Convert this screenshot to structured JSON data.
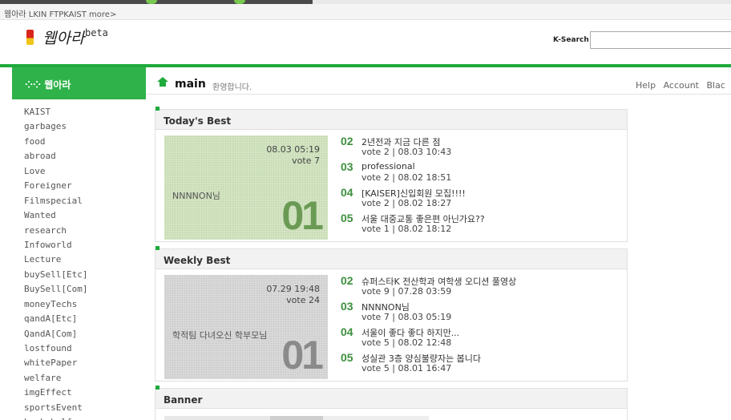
{
  "site_links": {
    "text": "웹아라 LKIN FTPKAIST more>"
  },
  "header": {
    "logo_text": "웹아라",
    "logo_beta": "beta",
    "search_label": "K-Search",
    "search_value": ""
  },
  "sidebar": {
    "title": "웹아라",
    "items": [
      "KAIST",
      "garbages",
      "food",
      "abroad",
      "Love",
      "Foreigner",
      "Filmspecial",
      "Wanted",
      "research",
      "Infoworld",
      "Lecture",
      "buySell[Etc]",
      "BuySell[Com]",
      "moneyTechs",
      "qandA[Etc]",
      "QandA[Com]",
      "lostfound",
      "whitePaper",
      "welfare",
      "imgEffect",
      "sportsEvent",
      "bookshelf"
    ]
  },
  "main": {
    "title": "main",
    "welcome": "환영합니다.",
    "top_links": [
      "Help",
      "Account",
      "Blac"
    ]
  },
  "todays_best": {
    "title": "Today's Best",
    "featured": {
      "date": "08.03 05:19",
      "vote": "vote 7",
      "author": "NNNNON님",
      "rank": "01"
    },
    "items": [
      {
        "rank": "02",
        "title": "2년전과 지금 다른 점",
        "meta": "vote 2 | 08.03 10:43"
      },
      {
        "rank": "03",
        "title": "professional",
        "meta": "vote 2 | 08.02 18:51"
      },
      {
        "rank": "04",
        "title": "[KAISER]신입회원 모집!!!!",
        "meta": "vote 2 | 08.02 18:27"
      },
      {
        "rank": "05",
        "title": "서울 대중교통 좋은편 아닌가요??",
        "meta": "vote 1 | 08.02 18:12"
      }
    ]
  },
  "weekly_best": {
    "title": "Weekly Best",
    "featured": {
      "date": "07.29 19:48",
      "vote": "vote 24",
      "author": "학적팀 다녀오신 학부모님",
      "rank": "01"
    },
    "items": [
      {
        "rank": "02",
        "title": "슈퍼스타K 전산학과 여학생 오디션 풀영상",
        "meta": "vote 9 | 07.28 03:59"
      },
      {
        "rank": "03",
        "title": "NNNNON님",
        "meta": "vote 7 | 08.03 05:19"
      },
      {
        "rank": "04",
        "title": "서울이 좋다 좋다 하지만...",
        "meta": "vote 5 | 08.02 12:48"
      },
      {
        "rank": "05",
        "title": "성실관 3층 양심불량자는 봅니다",
        "meta": "vote 5 | 08.01 16:47"
      }
    ]
  },
  "banner": {
    "title": "Banner"
  },
  "colors": {
    "brand_green": "#1faa3c",
    "sidebar_green": "#2fb24a",
    "rank_green": "#3d8f3d"
  },
  "icons": [
    "home-icon",
    "dots-icon",
    "logo-icon"
  ]
}
